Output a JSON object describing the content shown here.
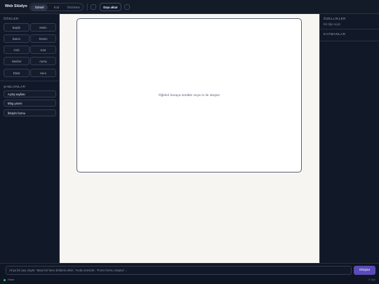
{
  "app": {
    "title": "Web Stüdyo"
  },
  "toolbar": {
    "tabs": [
      {
        "label": "Görsel",
        "active": true
      },
      {
        "label": "Kod",
        "active": false
      },
      {
        "label": "Önizleme",
        "active": false
      }
    ],
    "export_label": "Dışa aktar"
  },
  "left_panel": {
    "elements_title": "ÖĞELER",
    "elements": [
      "Başlık",
      "Metin",
      "Buton",
      "Resim",
      "Grid",
      "Kart",
      "Navbar",
      "Ayraç",
      "Efekt",
      "Hero"
    ],
    "templates_title": "ŞABLONLAR",
    "templates": [
      "Açılış sayfası",
      "Blog yazısı",
      "İletişim formu"
    ]
  },
  "canvas": {
    "placeholder": "Öğeleri buraya sürükle veya AI ile oluştur"
  },
  "right_panel": {
    "properties_title": "ÖZELLİKLER",
    "properties_empty": "Bir öğe seçin",
    "layers_title": "KATMANLAR"
  },
  "bottom": {
    "ai_placeholder": "AI'ya bir şey söyle: 'Mavi bir hero bölümü ekle', 'Kodu temizle', 'Form formu oluştur'...",
    "create_label": "Oluştur",
    "status": "Hazır",
    "element_count": "0 öğe"
  },
  "colors": {
    "accent": "#5a4bb8",
    "status_ok": "#2fbf71",
    "panel_bg": "#111827",
    "canvas_bg": "#f6f5f2"
  }
}
